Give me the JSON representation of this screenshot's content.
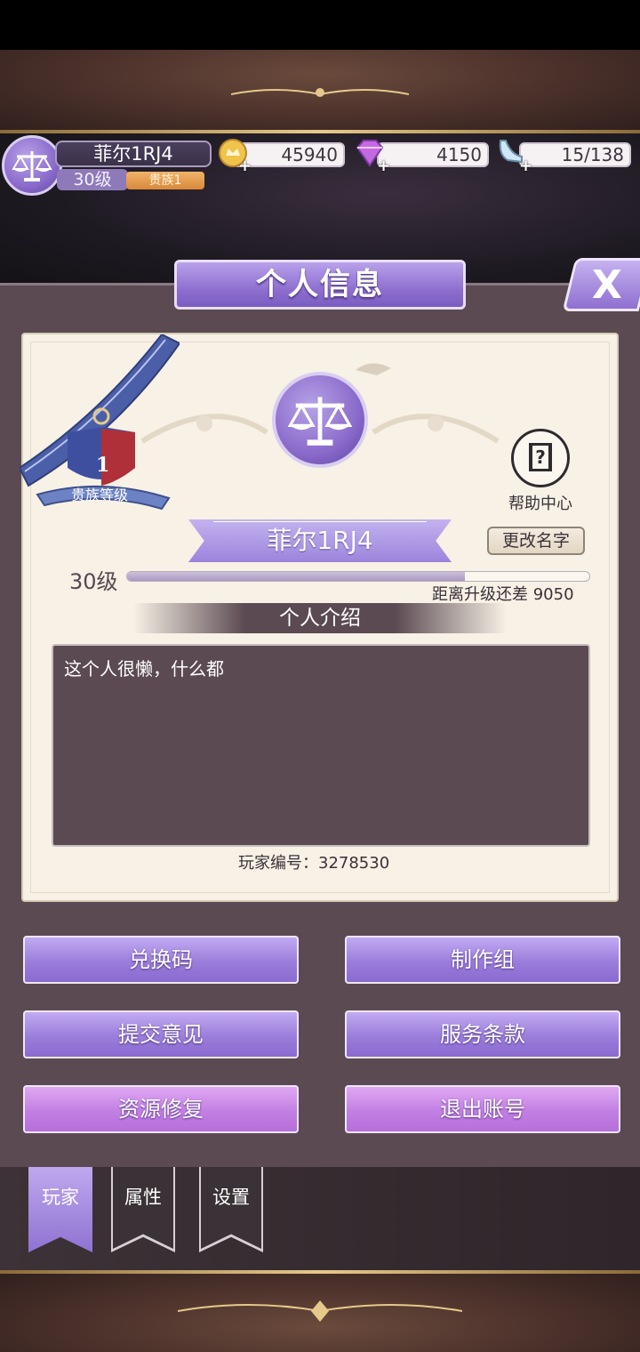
{
  "header": {
    "player_name": "菲尔1RJ4",
    "level": "30级",
    "noble_badge": "贵族1"
  },
  "resources": {
    "gold": "45940",
    "diamond": "4150",
    "stamina": "15/138"
  },
  "panel": {
    "title": "个人信息",
    "close_label": "X",
    "noble_level_number": "1",
    "noble_level_label": "贵族等级",
    "help_label": "帮助中心",
    "player_name": "菲尔1RJ4",
    "rename_label": "更改名字",
    "level_label": "30级",
    "xp_progress": 0.73,
    "xp_remaining": "距离升级还差 9050",
    "intro_header": "个人介绍",
    "intro_text": "这个人很懒，什么都",
    "player_id": "玩家编号：3278530"
  },
  "actions": {
    "redeem": "兑换码",
    "credits": "制作组",
    "feedback": "提交意见",
    "terms": "服务条款",
    "repair": "资源修复",
    "logout": "退出账号"
  },
  "tabs": [
    {
      "label": "玩家",
      "active": true
    },
    {
      "label": "属性",
      "active": false
    },
    {
      "label": "设置",
      "active": false
    }
  ],
  "colors": {
    "accent_purple": "#9b7ddb",
    "accent_pink": "#c27fe3",
    "panel_bg": "#5b4a52",
    "card_bg": "#f7f1e6"
  }
}
